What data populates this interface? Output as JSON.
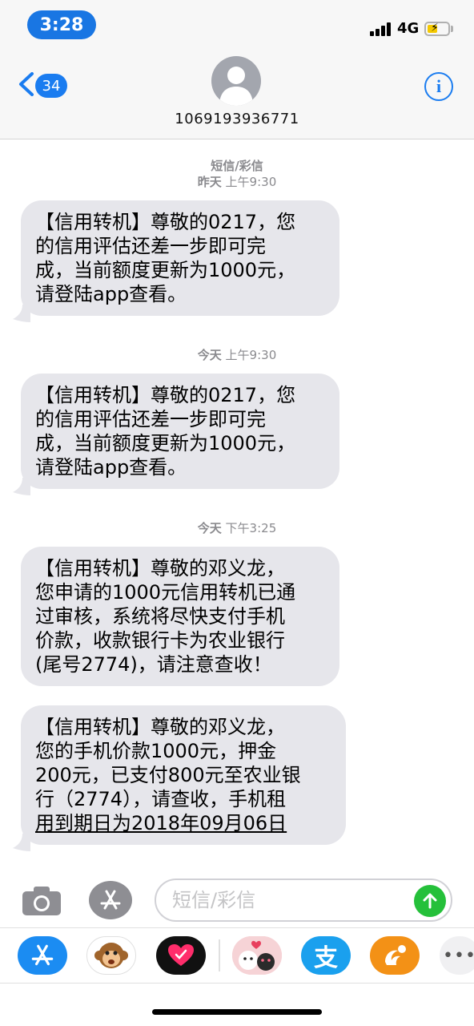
{
  "status_bar": {
    "time": "3:28",
    "network": "4G"
  },
  "header": {
    "back_count": "34",
    "contact": "1069193936771",
    "info_label": "i"
  },
  "thread": {
    "service_label": "短信/彩信",
    "messages": [
      {
        "day": "昨天",
        "time": "上午9:30",
        "lines": [
          "【信用转机】尊敬的0217，您",
          "的信用评估还差一步即可完",
          "成，当前额度更新为1000元，",
          "请登陆app查看。"
        ]
      },
      {
        "day": "今天",
        "time": "上午9:30",
        "lines": [
          "【信用转机】尊敬的0217，您",
          "的信用评估还差一步即可完",
          "成，当前额度更新为1000元，",
          "请登陆app查看。"
        ]
      },
      {
        "day": "今天",
        "time": "下午3:25",
        "lines": [
          "【信用转机】尊敬的邓义龙，",
          "您申请的1000元信用转机已通",
          "过审核，系统将尽快支付手机",
          "价款，收款银行卡为农业银行",
          "(尾号2774)，请注意查收！"
        ]
      },
      {
        "lines": [
          "【信用转机】尊敬的邓义龙，",
          "您的手机价款1000元，押金",
          "200元，已支付800元至农业银",
          "行（2774），请查收，手机租",
          "用到期日为2018年09月06日"
        ]
      }
    ]
  },
  "composer": {
    "placeholder": "短信/彩信"
  },
  "apps": [
    {
      "icon": "app-store-icon",
      "color": "#1b8cf2"
    },
    {
      "icon": "monkey-memoji-icon",
      "color": "#ffffff"
    },
    {
      "icon": "digital-touch-heart-icon",
      "color": "#111111"
    },
    {
      "icon": "sticker-app-icon",
      "color": "#f3c3c8"
    },
    {
      "icon": "alipay-icon",
      "color": "#1aa0ee"
    },
    {
      "icon": "uc-browser-icon",
      "color": "#f39116"
    },
    {
      "icon": "more-apps-icon",
      "color": "#f0f0f2"
    }
  ]
}
